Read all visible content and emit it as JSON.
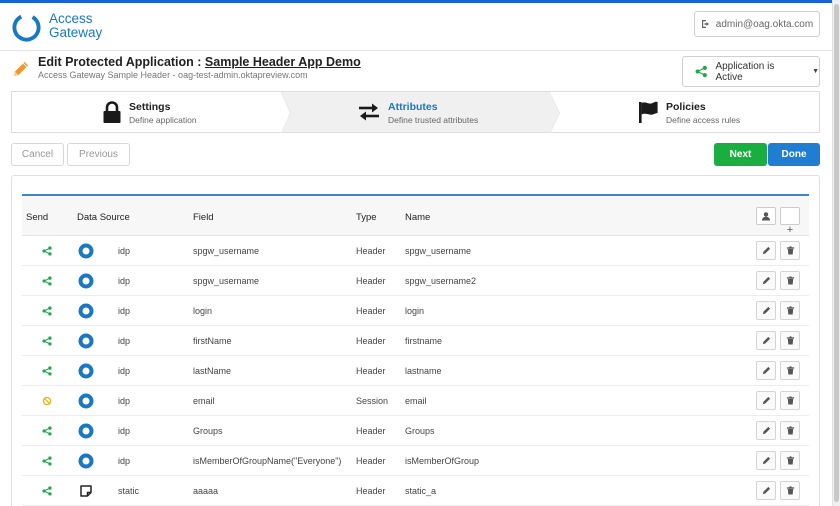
{
  "header": {
    "logo_line1": "Access",
    "logo_line2": "Gateway",
    "user_email": "admin@oag.okta.com"
  },
  "title": {
    "prefix": "Edit Protected Application : ",
    "app_name": "Sample Header App Demo",
    "subtitle": "Access Gateway Sample Header - oag-test-admin.oktapreview.com",
    "status_label": "Application is Active"
  },
  "wizard": {
    "steps": [
      {
        "title": "Settings",
        "desc": "Define application"
      },
      {
        "title": "Attributes",
        "desc": "Define trusted attributes"
      },
      {
        "title": "Policies",
        "desc": "Define access rules"
      }
    ]
  },
  "actions": {
    "cancel": "Cancel",
    "previous": "Previous",
    "next": "Next",
    "done": "Done"
  },
  "table": {
    "headers": {
      "send": "Send",
      "data_source": "Data Source",
      "field": "Field",
      "type": "Type",
      "name": "Name"
    },
    "rows": [
      {
        "send": "share",
        "source_icon": "idp-ring",
        "source": "idp",
        "field": "spgw_username",
        "type": "Header",
        "name": "spgw_username"
      },
      {
        "send": "share",
        "source_icon": "idp-ring",
        "source": "idp",
        "field": "spgw_username",
        "type": "Header",
        "name": "spgw_username2"
      },
      {
        "send": "share",
        "source_icon": "idp-ring",
        "source": "idp",
        "field": "login",
        "type": "Header",
        "name": "login"
      },
      {
        "send": "share",
        "source_icon": "idp-ring",
        "source": "idp",
        "field": "firstName",
        "type": "Header",
        "name": "firstname"
      },
      {
        "send": "share",
        "source_icon": "idp-ring",
        "source": "idp",
        "field": "lastName",
        "type": "Header",
        "name": "lastname"
      },
      {
        "send": "blocked",
        "source_icon": "idp-ring",
        "source": "idp",
        "field": "email",
        "type": "Session",
        "name": "email"
      },
      {
        "send": "share",
        "source_icon": "idp-ring",
        "source": "idp",
        "field": "Groups",
        "type": "Header",
        "name": "Groups"
      },
      {
        "send": "share",
        "source_icon": "idp-ring",
        "source": "idp",
        "field": "isMemberOfGroupName(\"Everyone\")",
        "type": "Header",
        "name": "isMemberOfGroup"
      },
      {
        "send": "share",
        "source_icon": "static-note",
        "source": "static",
        "field": "aaaaa",
        "type": "Header",
        "name": "static_a"
      }
    ]
  },
  "colors": {
    "brand_blue": "#1a78c2",
    "next_green": "#1aad3f",
    "done_blue": "#1f7dd2",
    "share_green": "#23a94b",
    "blocked_yellow": "#e5b81a"
  }
}
